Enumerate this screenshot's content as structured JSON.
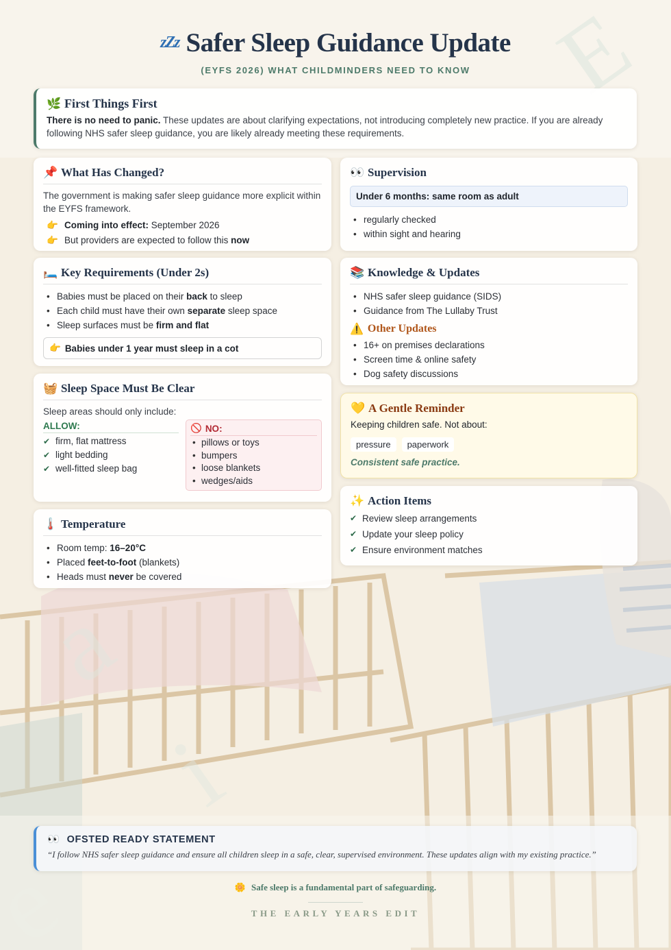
{
  "header": {
    "title": "Safer Sleep Guidance Update",
    "title_icon": "zzz-icon",
    "subtitle": "(EYFS 2026) WHAT CHILDMINDERS NEED TO KNOW"
  },
  "first": {
    "icon": "leaf-icon",
    "title": "First Things First",
    "lead": "There is no need to panic.",
    "body": " These updates are about clarifying expectations, not introducing completely new practice. If you are already following NHS safer sleep guidance, you are likely already meeting these requirements."
  },
  "changed": {
    "icon": "pushpin-icon",
    "title": "What Has Changed?",
    "intro": "The government is making safer sleep guidance more explicit within the EYFS framework.",
    "row1_bold": "Coming into effect:",
    "row1_rest": " September 2026",
    "row2_pre": "But providers are expected to follow this ",
    "row2_bold": "now"
  },
  "supervision": {
    "icon": "eyes-icon",
    "title": "Supervision",
    "highlight": "Under 6 months: same room as adult",
    "items": [
      "regularly checked",
      "within sight and hearing"
    ]
  },
  "key": {
    "icon": "bed-icon",
    "title": "Key Requirements (Under 2s)",
    "i1_pre": "Babies must be placed on their ",
    "i1_bold": "back",
    "i1_post": " to sleep",
    "i2_pre": "Each child must have their own ",
    "i2_bold": "separate",
    "i2_post": " sleep space",
    "i3_pre": "Sleep surfaces must be ",
    "i3_bold": "firm and flat",
    "callout": "Babies under 1 year must sleep in a cot"
  },
  "knowledge": {
    "icon": "books-icon",
    "title": "Knowledge & Updates",
    "items": [
      "NHS safer sleep guidance (SIDS)",
      "Guidance from The Lullaby Trust"
    ],
    "other_title": "Other Updates",
    "other_items": [
      "16+ on premises declarations",
      "Screen time & online safety",
      "Dog safety discussions"
    ]
  },
  "clear": {
    "icon": "basket-icon",
    "title": "Sleep Space Must Be Clear",
    "intro": "Sleep areas should only include:",
    "allow_title": "ALLOW:",
    "allow_items": [
      "firm, flat mattress",
      "light bedding",
      "well-fitted sleep bag"
    ],
    "no_title": "NO:",
    "no_items": [
      "pillows or toys",
      "bumpers",
      "loose blankets",
      "wedges/aids"
    ]
  },
  "gentle": {
    "icon": "yellow-heart-icon",
    "title": "A Gentle Reminder",
    "line": "Keeping children safe. Not about:",
    "chips": [
      "pressure",
      "paperwork"
    ],
    "footer": "Consistent safe practice."
  },
  "action": {
    "icon": "sparkles-icon",
    "title": "Action Items",
    "items": [
      "Review sleep arrangements",
      "Update your sleep policy",
      "Ensure environment matches"
    ]
  },
  "temperature": {
    "icon": "thermometer-icon",
    "title": "Temperature",
    "i1_pre": "Room temp: ",
    "i1_bold": "16–20°C",
    "i2_pre": "Placed ",
    "i2_bold": "feet-to-foot",
    "i2_post": " (blankets)",
    "i3_pre": "Heads must ",
    "i3_bold": "never",
    "i3_post": " be covered"
  },
  "ofsted": {
    "icon": "eyes-icon",
    "title": "OFSTED READY STATEMENT",
    "quote": "“I follow NHS safer sleep guidance and ensure all children sleep in a safe, clear, supervised environment. These updates align with my existing practice.”"
  },
  "footer": {
    "tagline": "Safe sleep is a fundamental part of safeguarding.",
    "brand": "THE EARLY YEARS EDIT"
  },
  "colors": {
    "accent_green": "#4d7a6a",
    "navy": "#25344a",
    "ofsted_blue": "#4a8fd6",
    "warning_orange": "#b0561a",
    "no_red": "#b22a34"
  }
}
